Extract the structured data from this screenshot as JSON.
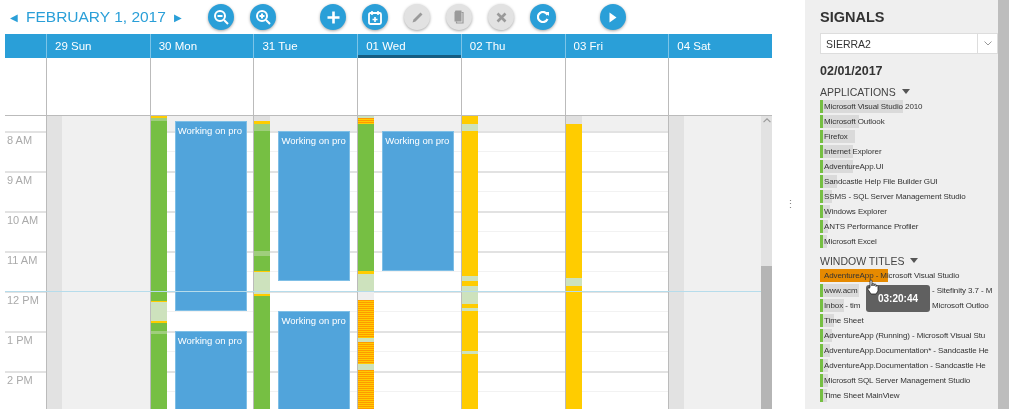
{
  "toolbar": {
    "prev": "◀",
    "title": "FEBRUARY 1, 2017",
    "next": "▶",
    "buttons": [
      {
        "kind": "zoom-out",
        "disabled": false
      },
      {
        "kind": "zoom-in",
        "disabled": false
      },
      {
        "kind": "add",
        "disabled": false
      },
      {
        "kind": "calendar-add",
        "disabled": false
      },
      {
        "kind": "edit",
        "disabled": true
      },
      {
        "kind": "copy",
        "disabled": true
      },
      {
        "kind": "delete",
        "disabled": true
      },
      {
        "kind": "refresh",
        "disabled": false
      },
      {
        "kind": "play",
        "disabled": false
      }
    ]
  },
  "calendar": {
    "days": [
      {
        "label": "29 Sun",
        "weekend": true,
        "selected": false
      },
      {
        "label": "30 Mon",
        "weekend": false,
        "selected": false,
        "events": [
          {
            "title": "Working on pro"
          },
          {
            "title": "Working on pro"
          }
        ]
      },
      {
        "label": "31 Tue",
        "weekend": false,
        "selected": false,
        "events": [
          {
            "title": "Working on pro"
          },
          {
            "title": "Working on pro"
          }
        ]
      },
      {
        "label": "01 Wed",
        "weekend": false,
        "selected": true,
        "events": [
          {
            "title": "Working on pro"
          }
        ]
      },
      {
        "label": "02 Thu",
        "weekend": false,
        "selected": false
      },
      {
        "label": "03 Fri",
        "weekend": false,
        "selected": false
      },
      {
        "label": "04 Sat",
        "weekend": true,
        "selected": false
      }
    ],
    "hours": [
      "8 AM",
      "9 AM",
      "10 AM",
      "11 AM",
      "12 PM",
      "1 PM",
      "2 PM"
    ]
  },
  "splitter": "⋮",
  "signals": {
    "title": "SIGNALS",
    "device": "SIERRA2",
    "date": "02/01/2017",
    "sections": [
      {
        "title": "APPLICATIONS",
        "expanded": true,
        "items": [
          {
            "text": "Microsoft Visual Studio 2010",
            "level": 0.45,
            "selected": false
          },
          {
            "text": "Microsoft Outlook",
            "level": 0.2,
            "selected": false
          },
          {
            "text": "Firefox",
            "level": 0.18,
            "selected": false
          },
          {
            "text": "Internet Explorer",
            "level": 0.17,
            "selected": false
          },
          {
            "text": "AdventureApp.UI",
            "level": 0.17,
            "selected": false
          },
          {
            "text": "Sandcastle Help File Builder GUI",
            "level": 0.08,
            "selected": false
          },
          {
            "text": "SSMS - SQL Server Management Studio",
            "level": 0.05,
            "selected": false
          },
          {
            "text": "Windows Explorer",
            "level": 0.04,
            "selected": false
          },
          {
            "text": "ANTS Performance Profiler",
            "level": 0.03,
            "selected": false
          },
          {
            "text": "Microsoft Excel",
            "level": 0.02,
            "selected": false
          }
        ]
      },
      {
        "title": "WINDOW TITLES",
        "expanded": true,
        "items": [
          {
            "text": "AdventureApp - Microsoft Visual Studio",
            "level": 0.3,
            "selected": true
          },
          {
            "text": "www.acm",
            "text_2": "- Sitefinity 3.7 - M",
            "level": 0.2,
            "selected": false
          },
          {
            "text": "Inbox - tim",
            "text_2": "Microsoft Outloo",
            "level": 0.12,
            "selected": false
          },
          {
            "text": "Time Sheet",
            "level": 0.06,
            "selected": false
          },
          {
            "text": "AdventureApp (Running) - Microsoft Visual Stu",
            "level": 0.05,
            "selected": false
          },
          {
            "text": "AdventureApp.Documentation* - Sandcastle He",
            "level": 0.04,
            "selected": false
          },
          {
            "text": "AdventureApp.Documentation - Sandcastle He",
            "level": 0.03,
            "selected": false
          },
          {
            "text": "Microsoft SQL Server Management Studio",
            "level": 0.03,
            "selected": false
          },
          {
            "text": "Time Sheet MainView",
            "level": 0.02,
            "selected": false
          }
        ]
      }
    ],
    "tooltip": "03:20:44"
  }
}
